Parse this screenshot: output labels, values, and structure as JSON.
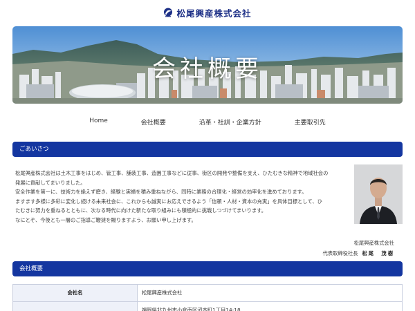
{
  "header": {
    "company_name": "松尾興産株式会社",
    "logo_icon": "company-logo-icon",
    "brand_color": "#1c2f86"
  },
  "hero": {
    "title": "会社概要"
  },
  "nav": {
    "items": [
      {
        "label": "Home"
      },
      {
        "label": "会社概要"
      },
      {
        "label": "沿革・社訓・企業方針"
      },
      {
        "label": "主要取引先"
      }
    ]
  },
  "greeting": {
    "heading": "ごあいさつ",
    "lines": [
      "松尾興産株式会社は土木工事をはじめ、管工事、舗装工事、造園工事などに従事、街区の開発や整備を支え、ひたむきな精神で地域社会の",
      "発展に貢献してまいりました。",
      "安全作業を第一に、技術力を絶えず磨き、経験と実績を積み重ねながら、同時に業務の合理化・経営の効率化を進めております。",
      "ますます多様に多彩に変化し続ける未来社会に、これからも誠実にお応えできるよう「信頼・人材・資本の充実」を具体目標として、ひ",
      "たむきに努力を重ねるとともに、次なる時代に向けた新たな取り組みにも積極的に挑戦しつづけてまいります。",
      "なにとぞ、今後とも一層のご指導ご鞭撻を賜りますよう、お願い申し上げます。"
    ],
    "signature_company": "松尾興産株式会社",
    "signature_title": "代表取締役社長",
    "signature_name": "松尾　茂樹"
  },
  "overview": {
    "heading": "会社概要",
    "rows": [
      {
        "label": "会社名",
        "value": "松尾興産株式会社"
      },
      {
        "label": "",
        "value": "福岡県北九州市小倉南区沼本町1丁目14-18"
      }
    ]
  },
  "colors": {
    "section_bar": "#1436a0",
    "table_header_bg": "#eef1f9",
    "table_border": "#c9cfdf"
  }
}
